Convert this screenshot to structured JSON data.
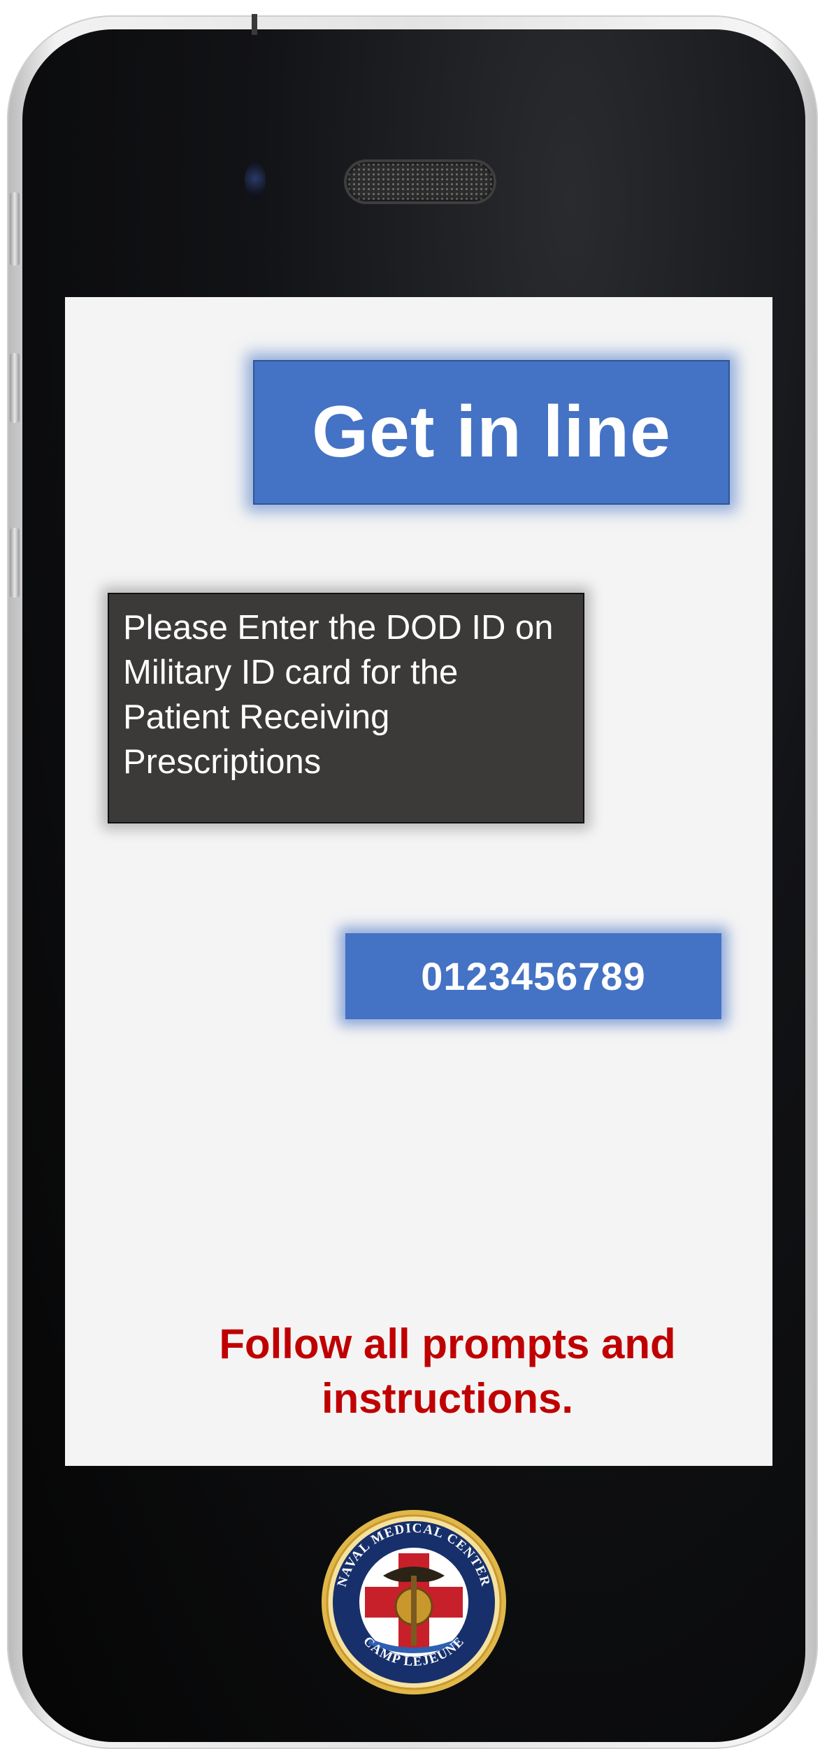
{
  "header": {
    "title": "Get in line"
  },
  "instruction": {
    "text": "Please Enter the DOD ID on Military ID card for the Patient Receiving Prescriptions"
  },
  "dod_id": {
    "value": "0123456789"
  },
  "footer": {
    "note": "Follow all prompts and instructions."
  },
  "seal": {
    "top_text": "NAVAL MEDICAL CENTER",
    "bottom_text": "CAMP LEJEUNE"
  },
  "colors": {
    "accent": "#4472c4",
    "warning": "#c00000",
    "panel": "#3b3a39",
    "screen": "#f4f4f4"
  }
}
